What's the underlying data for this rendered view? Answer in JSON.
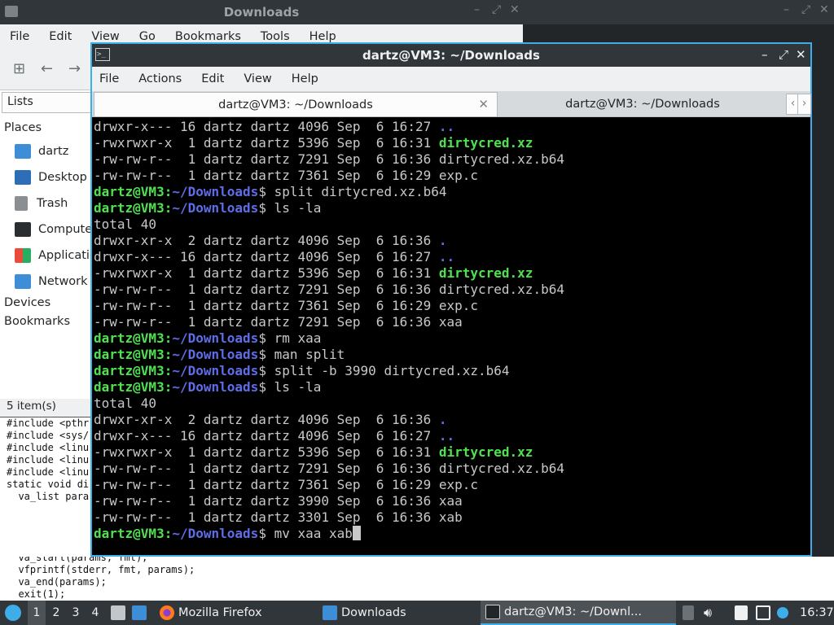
{
  "fm_window": {
    "title": "Downloads",
    "menu": [
      "File",
      "Edit",
      "View",
      "Go",
      "Bookmarks",
      "Tools",
      "Help"
    ],
    "sidebar_mode": "Lists",
    "places_heading": "Places",
    "places": [
      "dartz",
      "Desktop",
      "Trash",
      "Computer",
      "Applications",
      "Network"
    ],
    "devices_heading": "Devices",
    "bookmarks_heading": "Bookmarks",
    "status": "5 item(s)"
  },
  "code_editor": {
    "lines": [
      "#include <pthr",
      "#include <sys/",
      "",
      "#include <linu",
      "#include <linu",
      "",
      "#include <linu",
      "",
      "static void di",
      "  va_list para"
    ],
    "bottom_lines": [
      "  va_start(params, fmt);",
      "  vfprintf(stderr, fmt, params);",
      "  va_end(params);",
      "  exit(1);"
    ]
  },
  "terminal": {
    "title": "dartz@VM3: ~/Downloads",
    "menu": [
      "File",
      "Actions",
      "Edit",
      "View",
      "Help"
    ],
    "tabs": [
      "dartz@VM3: ~/Downloads",
      "dartz@VM3: ~/Downloads"
    ],
    "lines": [
      {
        "t": "drwxr-x--- 16 dartz dartz 4096 Sep  6 16:27 ",
        "d": ".."
      },
      {
        "t": "-rwxrwxr-x  1 dartz dartz 5396 Sep  6 16:31 ",
        "x": "dirtycred.xz"
      },
      {
        "t": "-rw-rw-r--  1 dartz dartz 7291 Sep  6 16:36 dirtycred.xz.b64"
      },
      {
        "t": "-rw-rw-r--  1 dartz dartz 7361 Sep  6 16:29 exp.c"
      },
      {
        "u": "dartz@VM3",
        "p": "~/Downloads",
        "cmd": "split dirtycred.xz.b64"
      },
      {
        "u": "dartz@VM3",
        "p": "~/Downloads",
        "cmd": "ls -la"
      },
      {
        "t": "total 40"
      },
      {
        "t": "drwxr-xr-x  2 dartz dartz 4096 Sep  6 16:36 ",
        "d": "."
      },
      {
        "t": "drwxr-x--- 16 dartz dartz 4096 Sep  6 16:27 ",
        "d": ".."
      },
      {
        "t": "-rwxrwxr-x  1 dartz dartz 5396 Sep  6 16:31 ",
        "x": "dirtycred.xz"
      },
      {
        "t": "-rw-rw-r--  1 dartz dartz 7291 Sep  6 16:36 dirtycred.xz.b64"
      },
      {
        "t": "-rw-rw-r--  1 dartz dartz 7361 Sep  6 16:29 exp.c"
      },
      {
        "t": "-rw-rw-r--  1 dartz dartz 7291 Sep  6 16:36 xaa"
      },
      {
        "u": "dartz@VM3",
        "p": "~/Downloads",
        "cmd": "rm xaa"
      },
      {
        "u": "dartz@VM3",
        "p": "~/Downloads",
        "cmd": "man split"
      },
      {
        "u": "dartz@VM3",
        "p": "~/Downloads",
        "cmd": "split -b 3990 dirtycred.xz.b64"
      },
      {
        "u": "dartz@VM3",
        "p": "~/Downloads",
        "cmd": "ls -la"
      },
      {
        "t": "total 40"
      },
      {
        "t": "drwxr-xr-x  2 dartz dartz 4096 Sep  6 16:36 ",
        "d": "."
      },
      {
        "t": "drwxr-x--- 16 dartz dartz 4096 Sep  6 16:27 ",
        "d": ".."
      },
      {
        "t": "-rwxrwxr-x  1 dartz dartz 5396 Sep  6 16:31 ",
        "x": "dirtycred.xz"
      },
      {
        "t": "-rw-rw-r--  1 dartz dartz 7291 Sep  6 16:36 dirtycred.xz.b64"
      },
      {
        "t": "-rw-rw-r--  1 dartz dartz 7361 Sep  6 16:29 exp.c"
      },
      {
        "t": "-rw-rw-r--  1 dartz dartz 3990 Sep  6 16:36 xaa"
      },
      {
        "t": "-rw-rw-r--  1 dartz dartz 3301 Sep  6 16:36 xab"
      },
      {
        "u": "dartz@VM3",
        "p": "~/Downloads",
        "cmd": "mv xaa xab",
        "cursor": true
      }
    ]
  },
  "taskbar": {
    "workspaces": [
      "1",
      "2",
      "3",
      "4"
    ],
    "active_workspace": "1",
    "apps": [
      "Mozilla Firefox",
      "Downloads",
      "dartz@VM3: ~/Downl..."
    ],
    "clock": "16:37"
  },
  "colors": {
    "accent": "#3daee9",
    "prompt_user": "#4fe24f",
    "prompt_path": "#5e6de8",
    "terminal_bg": "#000000"
  }
}
